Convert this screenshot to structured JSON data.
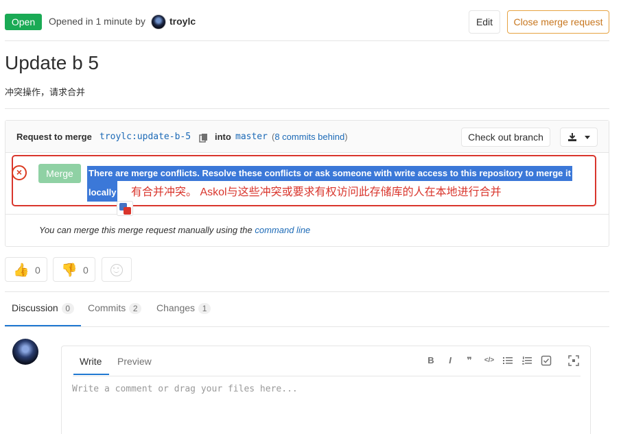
{
  "header": {
    "status_badge": "Open",
    "opened_text": "Opened in 1 minute by",
    "author": "troylc",
    "edit_label": "Edit",
    "close_label": "Close merge request"
  },
  "title": "Update b 5",
  "description": "冲突操作，请求合并",
  "merge_widget": {
    "request_text": "Request to merge",
    "source_branch": "troylc:update-b-5",
    "into_text": "into",
    "target_branch": "master",
    "behind_open": "(",
    "behind_link": "8 commits behind",
    "behind_close": ")",
    "checkout_label": "Check out branch",
    "merge_label": "Merge",
    "conflict_line1": "There are merge conflicts. Resolve these conflicts or ask someone with write access to this repository to merge it",
    "conflict_line2": "locally",
    "translation": "有合并冲突。 Askol与这些冲突或要求有权访问此存储库的人在本地进行合并",
    "manual_prefix": "You can merge this merge request manually using the",
    "manual_link": "command line"
  },
  "awards": {
    "thumbs_up_count": "0",
    "thumbs_down_count": "0"
  },
  "tabs": [
    {
      "label": "Discussion",
      "count": "0"
    },
    {
      "label": "Commits",
      "count": "2"
    },
    {
      "label": "Changes",
      "count": "1"
    }
  ],
  "comment": {
    "write_tab": "Write",
    "preview_tab": "Preview",
    "placeholder": "Write a comment or drag your files here...",
    "toolbar": [
      "B",
      "I",
      "❞",
      "</>",
      "list",
      "ordered-list",
      "task-list",
      "fullscreen"
    ]
  },
  "colors": {
    "open_green": "#1aaa55",
    "link_blue": "#1b69b6",
    "close_orange": "#e6a240",
    "annotation_red": "#d9352c",
    "selection_blue": "#3b78d8"
  }
}
